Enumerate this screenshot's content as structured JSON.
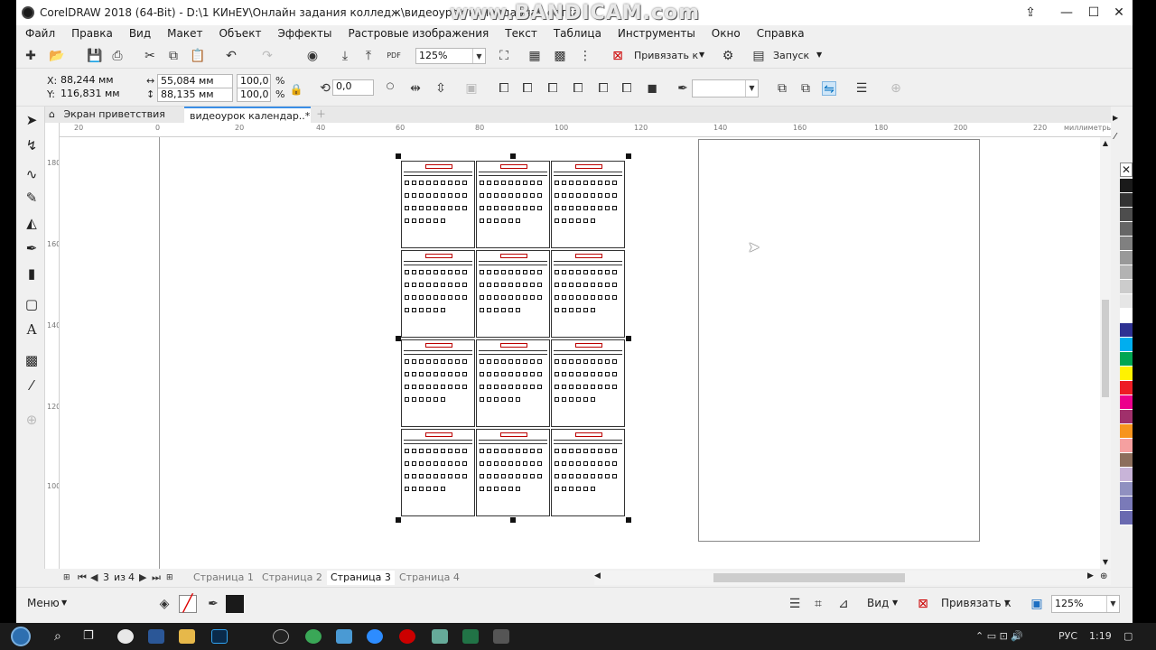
{
  "window": {
    "title": "CorelDRAW 2018 (64-Bit) - D:\\1 КИнЕУ\\Онлайн задания колледж\\видеоурок календарная сетка",
    "watermark": "www.BANDICAM.com"
  },
  "menu": [
    "Файл",
    "Правка",
    "Вид",
    "Макет",
    "Объект",
    "Эффекты",
    "Растровые изображения",
    "Текст",
    "Таблица",
    "Инструменты",
    "Окно",
    "Справка"
  ],
  "standard_toolbar": {
    "zoom": "125%",
    "snap_label": "Привязать к",
    "launch_label": "Запуск"
  },
  "property_bar": {
    "x_label": "X:",
    "x_value": "88,244 мм",
    "y_label": "Y:",
    "y_value": "116,831 мм",
    "width_value": "55,084 мм",
    "height_value": "88,135 мм",
    "scale_w": "100,0",
    "scale_h": "100,0",
    "percent": "%",
    "rotation": "0,0",
    "outline_value": ""
  },
  "doc_tabs": [
    "Экран приветствия",
    "видеоурок календар..*"
  ],
  "ruler": {
    "h_ticks": [
      "20",
      "0",
      "20",
      "40",
      "60",
      "80",
      "100",
      "120",
      "140",
      "160",
      "180",
      "200",
      "220"
    ],
    "h_unit": "миллиметры",
    "v_ticks": [
      "180",
      "160",
      "140",
      "120",
      "100"
    ]
  },
  "page_nav": {
    "current": "3",
    "of_label": "из",
    "total": "4",
    "pages": [
      "Страница 1",
      "Страница 2",
      "Страница 3",
      "Страница 4"
    ],
    "active_index": 2
  },
  "status": {
    "menu_label": "Меню",
    "view_label": "Вид",
    "snap_label": "Привязать к",
    "zoom": "125%"
  },
  "palette_colors": [
    "#1a1a1a",
    "#333333",
    "#4d4d4d",
    "#666666",
    "#808080",
    "#999999",
    "#b3b3b3",
    "#cccccc",
    "#e6e6e6",
    "#ffffff",
    "#2e3192",
    "#00aeef",
    "#00a651",
    "#fff200",
    "#ed1c24",
    "#ec008c",
    "#a0306b",
    "#f7941d",
    "#f5a0a0",
    "#8c6e5c",
    "#c8b4d8",
    "#9090c0",
    "#7a7ab8",
    "#6a6ab0"
  ],
  "taskbar": {
    "lang": "РУС",
    "time": "1:19"
  }
}
